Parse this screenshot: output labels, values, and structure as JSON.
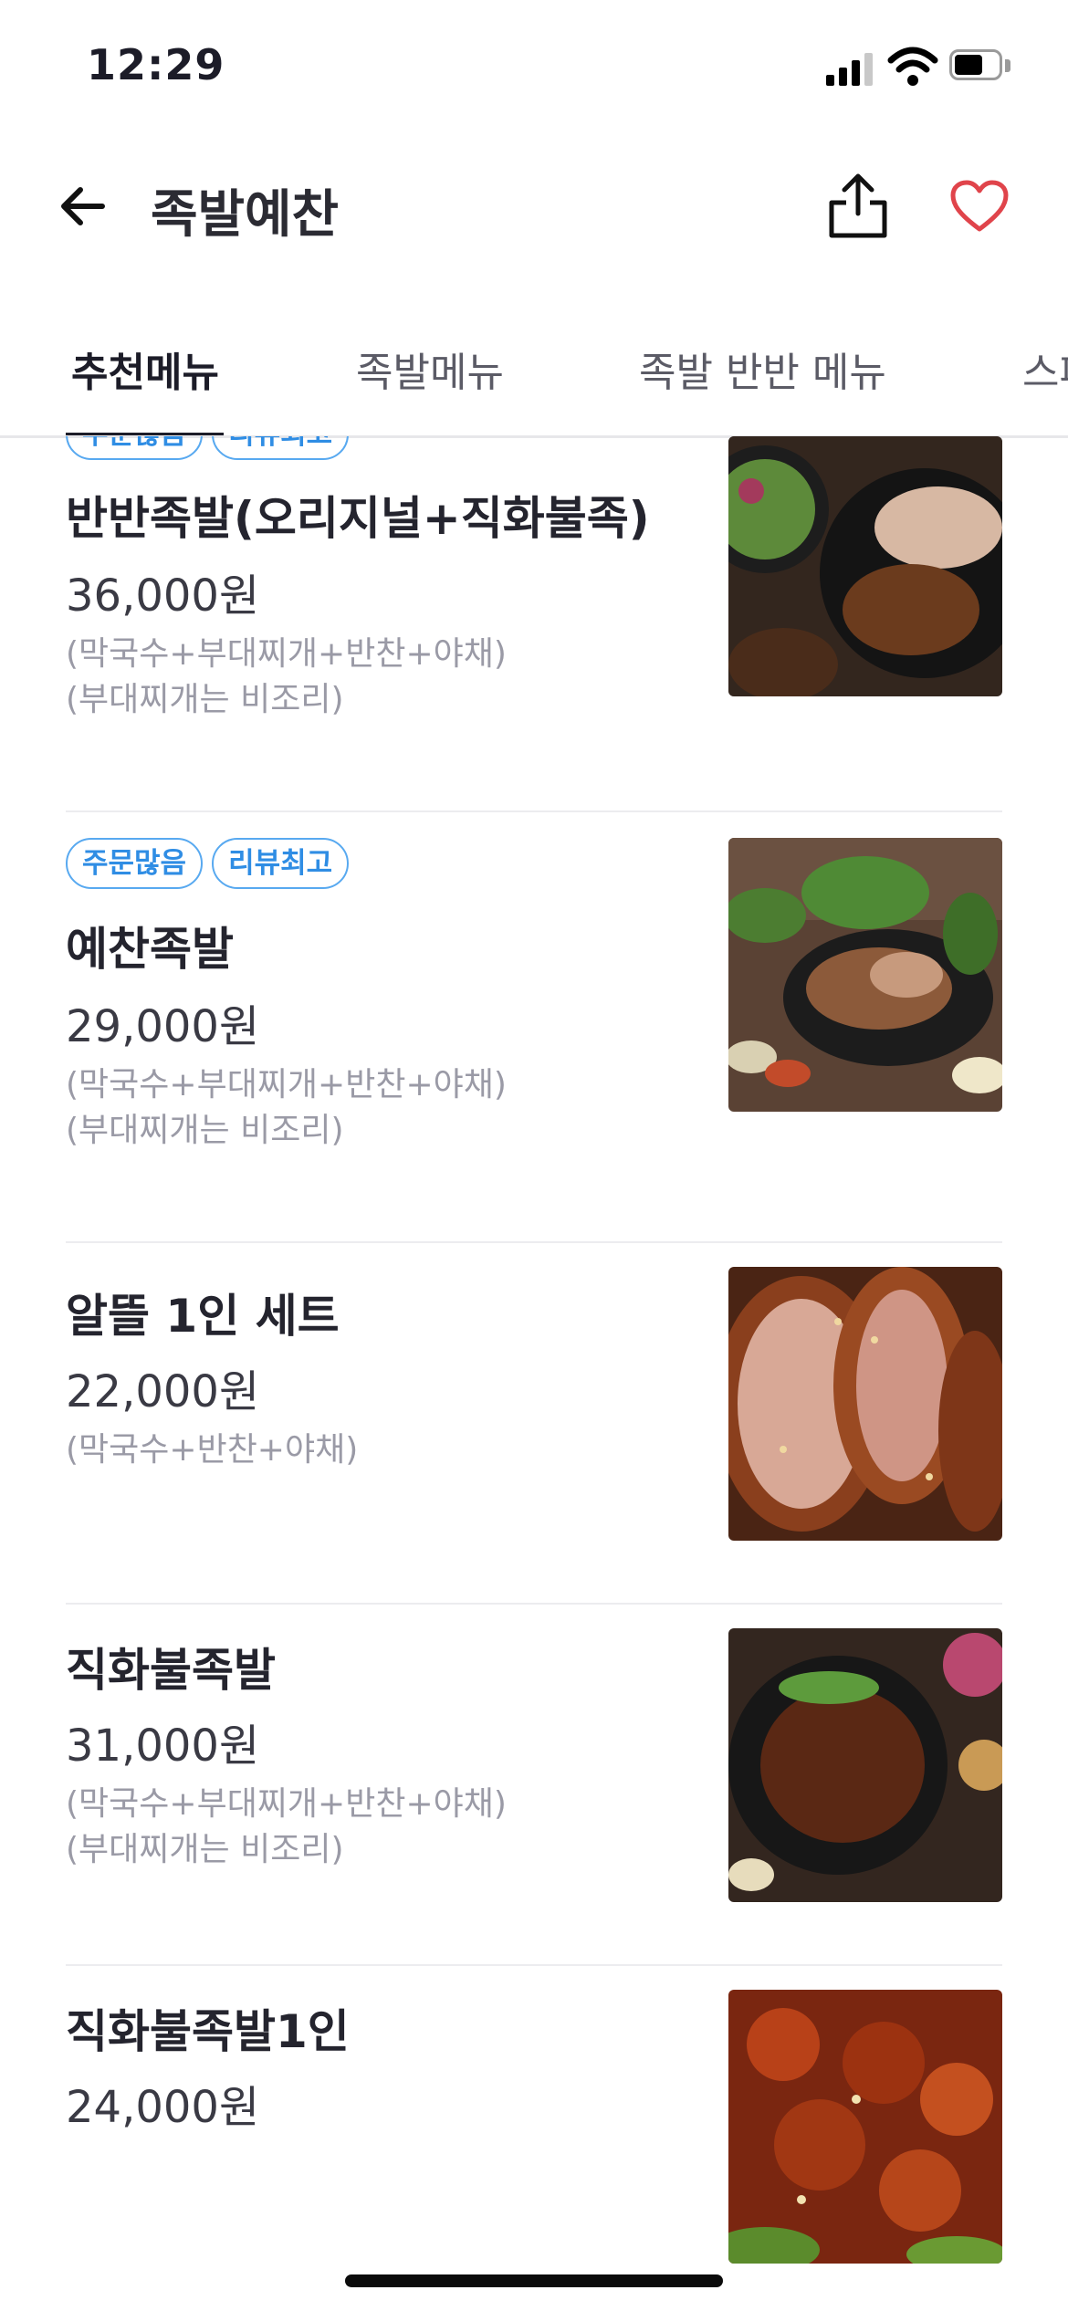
{
  "status_bar": {
    "time": "12:29"
  },
  "header": {
    "title": "족발예찬"
  },
  "tabs": [
    "추천메뉴",
    "족발메뉴",
    "족발 반반 메뉴",
    "스페셜"
  ],
  "menu": [
    {
      "badges": [
        "주문많음",
        "리뷰최고"
      ],
      "name": "반반족발(오리지널+직화불족)",
      "price": "36,000원",
      "desc1": "(막국수+부대찌개+반찬+야채)",
      "desc2": "(부대찌개는 비조리)"
    },
    {
      "badges": [
        "주문많음",
        "리뷰최고"
      ],
      "name": "예찬족발",
      "price": "29,000원",
      "desc1": "(막국수+부대찌개+반찬+야채)",
      "desc2": "(부대찌개는 비조리)"
    },
    {
      "badges": [],
      "name": "알뜰 1인 세트",
      "price": "22,000원",
      "desc1": "(막국수+반찬+야채)",
      "desc2": ""
    },
    {
      "badges": [],
      "name": "직화불족발",
      "price": "31,000원",
      "desc1": "(막국수+부대찌개+반찬+야채)",
      "desc2": "(부대찌개는 비조리)"
    },
    {
      "badges": [],
      "name": "직화불족발1인",
      "price": "24,000원",
      "desc1": "",
      "desc2": ""
    }
  ],
  "colors": {
    "accent_blue": "#2f8de4",
    "heart_red": "#e0444b",
    "text_dark": "#1c1c28"
  },
  "icons": [
    "signal-icon",
    "wifi-icon",
    "battery-icon",
    "back-arrow-icon",
    "share-icon",
    "heart-icon"
  ]
}
